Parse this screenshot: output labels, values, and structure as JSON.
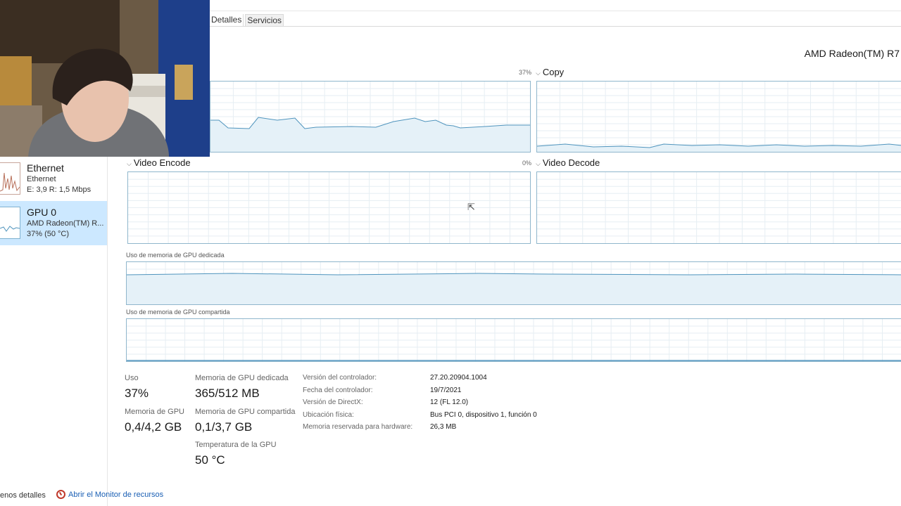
{
  "tabs": [
    {
      "label": "Detalles"
    },
    {
      "label": "Servicios"
    }
  ],
  "sidebar": {
    "items": [
      {
        "title": "Ethernet",
        "line1": "Ethernet",
        "line2": "E: 3,9 R: 1,5 Mbps"
      },
      {
        "title": "GPU 0",
        "line1": "AMD Radeon(TM) R...",
        "line2": "37% (50 °C)"
      }
    ]
  },
  "header": {
    "gpu_name": "AMD Radeon(TM) R7"
  },
  "graphs": {
    "engine3d": {
      "percent": "37%"
    },
    "copy": {
      "label": "Copy"
    },
    "video_encode": {
      "label": "Video Encode",
      "percent": "0%"
    },
    "video_decode": {
      "label": "Video Decode"
    },
    "dedicated_label": "Uso de memoria de GPU dedicada",
    "shared_label": "Uso de memoria de GPU compartida"
  },
  "stats": {
    "usage": {
      "label": "Uso",
      "value": "37%"
    },
    "gpu_memory": {
      "label": "Memoria de GPU",
      "value": "0,4/4,2 GB"
    },
    "dedicated": {
      "label": "Memoria de GPU dedicada",
      "value": "365/512 MB"
    },
    "shared": {
      "label": "Memoria de GPU compartida",
      "value": "0,1/3,7 GB"
    },
    "temperature": {
      "label": "Temperatura de la GPU",
      "value": "50 °C"
    }
  },
  "info": [
    {
      "key": "Versión del controlador:",
      "value": "27.20.20904.1004"
    },
    {
      "key": "Fecha del controlador:",
      "value": "19/7/2021"
    },
    {
      "key": "Versión de DirectX:",
      "value": "12 (FL 12.0)"
    },
    {
      "key": "Ubicación física:",
      "value": "Bus PCI 0, dispositivo 1, función 0"
    },
    {
      "key": "Memoria reservada para hardware:",
      "value": "26,3 MB"
    }
  ],
  "footer": {
    "less_details": "enos detalles",
    "resource_monitor": "Abrir el Monitor de recursos"
  },
  "colors": {
    "accent": "#4f94bd",
    "selected": "#cce8ff",
    "grid": "#e6eef3"
  }
}
